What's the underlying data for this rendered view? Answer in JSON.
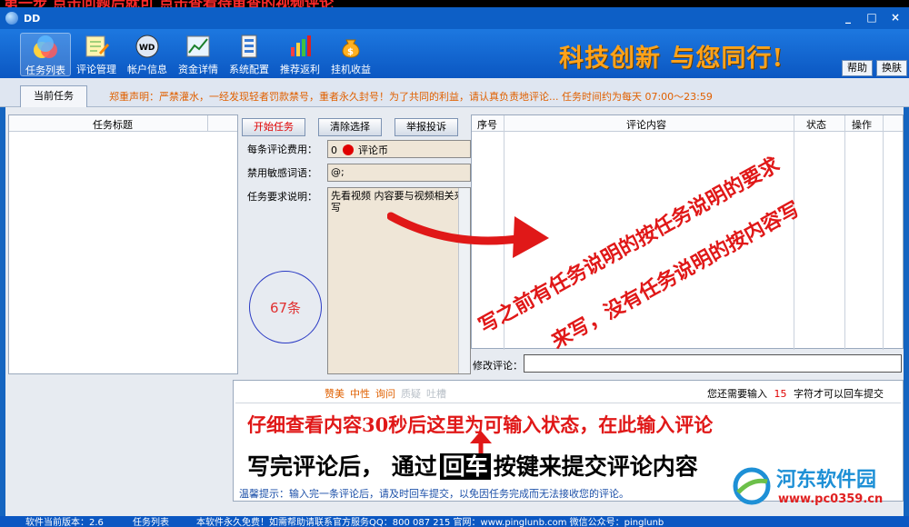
{
  "top_strip_text": "第一步 点击问题后就可 点击查看待审查的视频评论",
  "window": {
    "title": "DD",
    "controls": [
      "_",
      "□",
      "×"
    ]
  },
  "toolbar": {
    "items": [
      {
        "label": "任务列表",
        "icon": "task-list-icon",
        "active": true
      },
      {
        "label": "评论管理",
        "icon": "comment-manage-icon"
      },
      {
        "label": "帐户信息",
        "icon": "account-info-icon"
      },
      {
        "label": "资金详情",
        "icon": "funds-chart-icon"
      },
      {
        "label": "系统配置",
        "icon": "settings-icon"
      },
      {
        "label": "推荐返利",
        "icon": "rebate-chart-icon"
      },
      {
        "label": "挂机收益",
        "icon": "money-bag-icon"
      }
    ],
    "slogan": "科技创新  与您同行!",
    "help": "帮助",
    "switch": "换肤"
  },
  "tabs": {
    "current": "当前任务"
  },
  "notice": "郑重声明：严禁灌水，一经发现轻者罚款禁号，重者永久封号！为了共同的利益，请认真负责地评论...    任务时间约为每天 07:00～23:59",
  "left_panel": {
    "header": "任务标题"
  },
  "center_panel": {
    "start_btn": "开始任务",
    "clear_btn": "清除选择",
    "report_btn": "举报投诉",
    "cost_label": "每条评论费用：",
    "cost_value": "0",
    "cost_unit": "评论币",
    "sensitive_label": "禁用敏感词语：",
    "sensitive_value": "@;",
    "req_label": "任务要求说明：",
    "req_value": "先看视频 内容要与视频相关来写",
    "count": "67条"
  },
  "right_panel": {
    "columns": [
      "序号",
      "评论内容",
      "状态",
      "操作"
    ],
    "edit_label": "修改评论："
  },
  "bottom": {
    "tags": [
      "赞美",
      "中性",
      "询问",
      "质疑",
      "吐槽"
    ],
    "need_input_prefix": "您还需要输入",
    "need_input_count": "15",
    "need_input_suffix": "字符才可以回车提交",
    "tip": "温馨提示：输入完一条评论后，请及时回车提交，以免因任务完成而无法接收您的评论。"
  },
  "annotations": {
    "diag1": "写之前有任务说明的按任务说明的要求",
    "diag2": "来写，没有任务说明的按内容写",
    "line1": "仔细查看内容30秒后这里为可输入状态，在此输入评论",
    "line2_pre": "写完评论后，  通过",
    "line2_key": "回车",
    "line2_post": "按键来提交评论内容"
  },
  "statusbar": {
    "version": "软件当前版本：2.6",
    "tab": "任务列表",
    "info": "本软件永久免费！如需帮助请联系官方服务QQ：800 087 215 官网：www.pinglunb.com 微信公众号：pinglunb"
  },
  "watermark": {
    "name": "河东软件园",
    "url": "www.pc0359.cn"
  },
  "colors": {
    "accent": "#0b57c2",
    "slogan": "#ffa31a",
    "annotation": "#e01818",
    "notice": "#e06000"
  }
}
